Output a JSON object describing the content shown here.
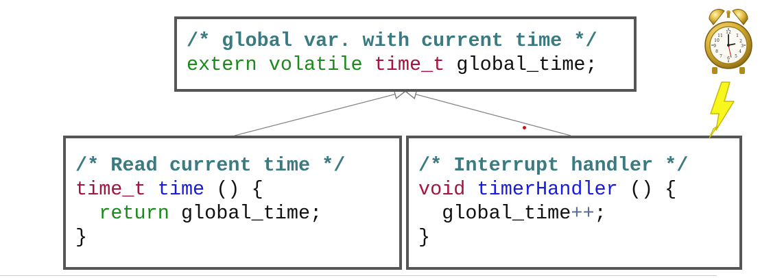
{
  "global_box": {
    "comment": "/* global var. with current time */",
    "decl_extern": "extern",
    "decl_volatile": "volatile",
    "decl_type": "time_t",
    "decl_name": "global_time;"
  },
  "read_box": {
    "comment": "/* Read current time */",
    "ret_type": "time_t",
    "fn_name": "time",
    "fn_sig_rest": " () {",
    "return_kw": "return",
    "return_expr": " global_time;",
    "close_brace": "}"
  },
  "irq_box": {
    "comment": "/* Interrupt handler */",
    "ret_type": "void",
    "fn_name": "timerHandler",
    "fn_sig_rest": " () {",
    "stmt_var": "global_time",
    "stmt_op": "++",
    "stmt_end": ";",
    "close_brace": "}"
  },
  "icons": {
    "clock": "alarm-clock-icon",
    "lightning": "lightning-bolt-icon"
  },
  "colors": {
    "comment": "#3b7a80",
    "keyword": "#1a8a1a",
    "type": "#a8123e",
    "function": "#1a1ae6",
    "border": "#555555"
  }
}
